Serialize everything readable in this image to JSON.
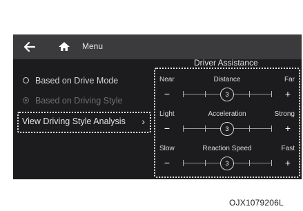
{
  "header": {
    "menu_label": "Menu"
  },
  "left": {
    "options": [
      {
        "label": "Based on Drive Mode",
        "selected": false,
        "enabled": true
      },
      {
        "label": "Based on Driving Style",
        "selected": true,
        "enabled": false
      }
    ],
    "view_button": "View Driving Style Analysis",
    "view_chevron": "›"
  },
  "panel": {
    "title": "Driver Assistance",
    "sliders": [
      {
        "min_label": "Near",
        "name": "Distance",
        "max_label": "Far",
        "value": 3,
        "value_text": "3",
        "ticks": 5
      },
      {
        "min_label": "Light",
        "name": "Acceleration",
        "max_label": "Strong",
        "value": 3,
        "value_text": "3",
        "ticks": 5
      },
      {
        "min_label": "Slow",
        "name": "Reaction Speed",
        "max_label": "Fast",
        "value": 3,
        "value_text": "3",
        "ticks": 5
      }
    ]
  },
  "caption": "OJX1079206L",
  "colors": {
    "background": "#1c1c1e",
    "topbar": "#3b3b3d",
    "text": "#e6e6e6",
    "disabled": "#6f6f72"
  }
}
